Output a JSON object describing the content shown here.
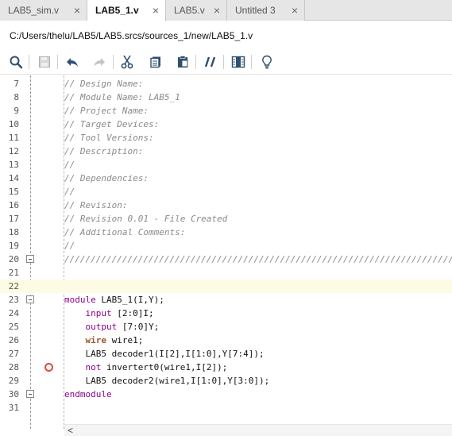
{
  "tabs": [
    {
      "label": "LAB5_sim.v",
      "active": false
    },
    {
      "label": "LAB5_1.v",
      "active": true
    },
    {
      "label": "LAB5.v",
      "active": false
    },
    {
      "label": "Untitled 3",
      "active": false
    }
  ],
  "tab_close_glyph": "×",
  "path": "C:/Users/thelu/LAB5/LAB5.srcs/sources_1/new/LAB5_1.v",
  "toolbar": {
    "icons": [
      "search-icon",
      "save-icon",
      "undo-icon",
      "redo-icon",
      "cut-icon",
      "copy-icon",
      "paste-icon",
      "comment-icon",
      "columns-icon",
      "lightbulb-icon"
    ]
  },
  "colors": {
    "comment": "#8a8a8a",
    "keyword": "#8b008b",
    "highlight": "#fdfbe4",
    "breakpoint": "#e24a3b"
  },
  "editor": {
    "lines": [
      {
        "n": "7",
        "text": "// Design Name:"
      },
      {
        "n": "8",
        "text": "// Module Name: LAB5_1"
      },
      {
        "n": "9",
        "text": "// Project Name:"
      },
      {
        "n": "10",
        "text": "// Target Devices:"
      },
      {
        "n": "11",
        "text": "// Tool Versions:"
      },
      {
        "n": "12",
        "text": "// Description:"
      },
      {
        "n": "13",
        "text": "//"
      },
      {
        "n": "14",
        "text": "// Dependencies:"
      },
      {
        "n": "15",
        "text": "//"
      },
      {
        "n": "16",
        "text": "// Revision:"
      },
      {
        "n": "17",
        "text": "// Revision 0.01 - File Created"
      },
      {
        "n": "18",
        "text": "// Additional Comments:"
      },
      {
        "n": "19",
        "text": "//"
      },
      {
        "n": "20",
        "text": "//////////////////////////////////////////////////////////////////////////////////"
      },
      {
        "n": "21",
        "text": ""
      },
      {
        "n": "22",
        "text": ""
      },
      {
        "n": "23",
        "kw": "module",
        "rest": " LAB5_1(I,Y);"
      },
      {
        "n": "24",
        "indent": "    ",
        "kw": "input",
        "rest": " [2:0]I;"
      },
      {
        "n": "25",
        "indent": "    ",
        "kw": "output",
        "rest": " [7:0]Y;"
      },
      {
        "n": "26",
        "indent": "    ",
        "kw": "wire",
        "rest": " wire1;"
      },
      {
        "n": "27",
        "indent": "    ",
        "rest": "LAB5 decoder1(I[2],I[1:0],Y[7:4]);"
      },
      {
        "n": "28",
        "indent": "    ",
        "kw": "not",
        "rest": " invertert0(wire1,I[2]);"
      },
      {
        "n": "29",
        "indent": "    ",
        "rest": "LAB5 decoder2(wire1,I[1:0],Y[3:0]);"
      },
      {
        "n": "30",
        "kw": "endmodule",
        "rest": ""
      },
      {
        "n": "31",
        "text": ""
      }
    ]
  },
  "hscroll_arrow": "<"
}
